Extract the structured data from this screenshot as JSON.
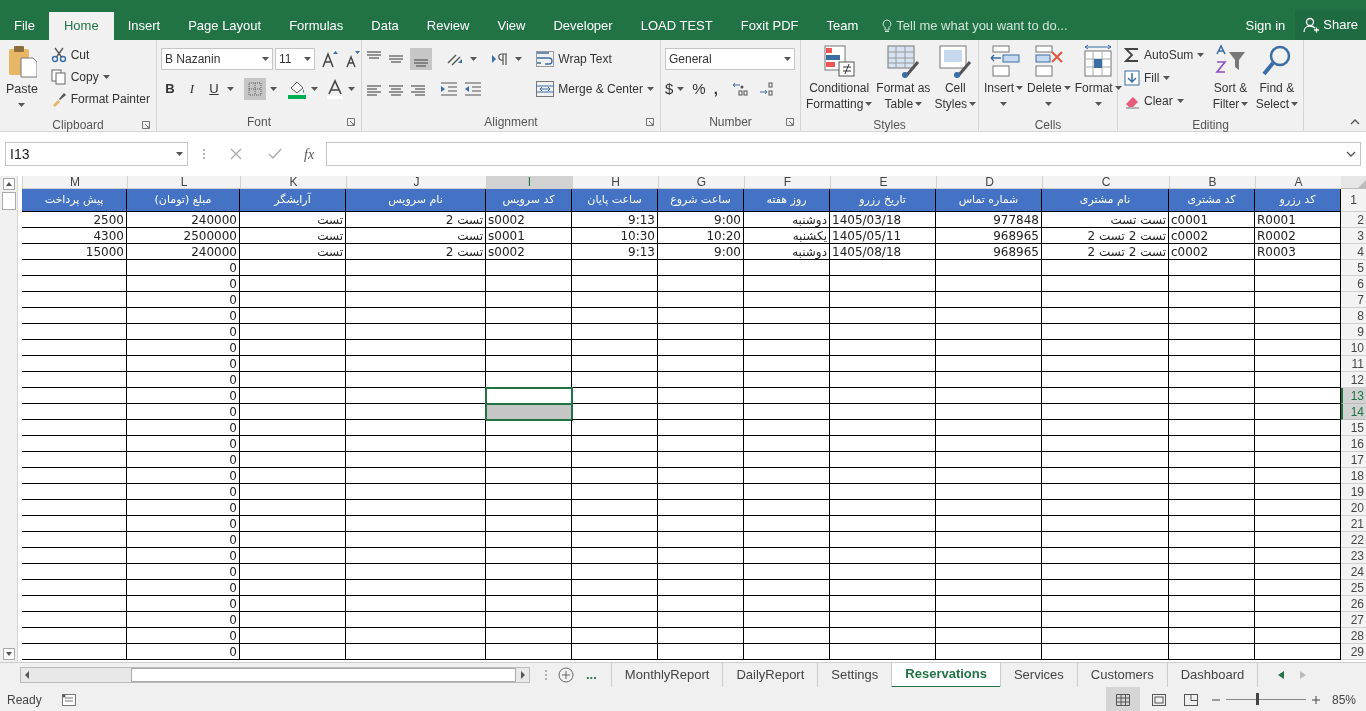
{
  "ribbon_tabs": [
    {
      "label": "File",
      "selected": false
    },
    {
      "label": "Home",
      "selected": true
    },
    {
      "label": "Insert",
      "selected": false
    },
    {
      "label": "Page Layout",
      "selected": false
    },
    {
      "label": "Formulas",
      "selected": false
    },
    {
      "label": "Data",
      "selected": false
    },
    {
      "label": "Review",
      "selected": false
    },
    {
      "label": "View",
      "selected": false
    },
    {
      "label": "Developer",
      "selected": false
    },
    {
      "label": "LOAD TEST",
      "selected": false
    },
    {
      "label": "Foxit PDF",
      "selected": false
    },
    {
      "label": "Team",
      "selected": false
    }
  ],
  "tell_me": "Tell me what you want to do...",
  "sign_in": "Sign in",
  "share": "Share",
  "clipboard": {
    "paste": "Paste",
    "cut": "Cut",
    "copy": "Copy",
    "format_painter": "Format Painter",
    "label": "Clipboard"
  },
  "font": {
    "name": "B Nazanin",
    "size": "11",
    "style_buttons": [
      "B",
      "I",
      "U"
    ],
    "label": "Font"
  },
  "alignment": {
    "wrap_text": "Wrap Text",
    "merge_center": "Merge & Center",
    "label": "Alignment"
  },
  "number": {
    "format": "General",
    "buttons": [
      "$",
      "%",
      ","
    ],
    "label": "Number"
  },
  "styles": {
    "buttons": [
      [
        "Conditional",
        "Formatting"
      ],
      [
        "Format as",
        "Table"
      ],
      [
        "Cell",
        "Styles"
      ]
    ],
    "label": "Styles"
  },
  "cells": {
    "buttons": [
      "Insert",
      "Delete",
      "Format"
    ],
    "label": "Cells"
  },
  "editing": {
    "autosum": "AutoSum",
    "fill": "Fill",
    "clear": "Clear",
    "sort": [
      "Sort &",
      "Filter"
    ],
    "find": [
      "Find &",
      "Select"
    ],
    "label": "Editing"
  },
  "formula_bar": {
    "name_box": "I13",
    "fx": "fx"
  },
  "columns": [
    {
      "letter": "M",
      "selected": false
    },
    {
      "letter": "L",
      "selected": false
    },
    {
      "letter": "K",
      "selected": false
    },
    {
      "letter": "J",
      "selected": false
    },
    {
      "letter": "I",
      "selected": true
    },
    {
      "letter": "H",
      "selected": false
    },
    {
      "letter": "G",
      "selected": false
    },
    {
      "letter": "F",
      "selected": false
    },
    {
      "letter": "E",
      "selected": false
    },
    {
      "letter": "D",
      "selected": false
    },
    {
      "letter": "C",
      "selected": false
    },
    {
      "letter": "B",
      "selected": false
    },
    {
      "letter": "A",
      "selected": false
    }
  ],
  "header_row": {
    "number": "1",
    "cells": {
      "A": "کد رزرو",
      "B": "کد مشتری",
      "C": "نام مشتری",
      "D": "شماره تماس",
      "E": "تاریخ رزرو",
      "F": "روز هفته",
      "G": "ساعت شروع",
      "H": "ساعت پایان",
      "I": "کد سرویس",
      "J": "نام سرویس",
      "K": "آرایشگر",
      "L": "مبلغ (تومان)",
      "M": "پیش پرداخت"
    }
  },
  "rows": [
    {
      "number": "2",
      "selected": false,
      "cells": {
        "A": "R0001",
        "B": "c0001",
        "C": "تست تست",
        "D": "977848",
        "E": "1405/03/18",
        "F": "دوشنبه",
        "G": "9:00",
        "H": "9:13",
        "I": "s0002",
        "J": "تست 2",
        "K": "تست",
        "L": "240000",
        "M": "2500"
      }
    },
    {
      "number": "3",
      "selected": false,
      "cells": {
        "A": "R0002",
        "B": "c0002",
        "C": "تست 2 تست 2",
        "D": "968965",
        "E": "1405/05/11",
        "F": "یکشنبه",
        "G": "10:20",
        "H": "10:30",
        "I": "s0001",
        "J": "تست",
        "K": "تست",
        "L": "2500000",
        "M": "4300"
      }
    },
    {
      "number": "4",
      "selected": false,
      "cells": {
        "A": "R0003",
        "B": "c0002",
        "C": "تست 2 تست 2",
        "D": "968965",
        "E": "1405/08/18",
        "F": "دوشنبه",
        "G": "9:00",
        "H": "9:13",
        "I": "s0002",
        "J": "تست 2",
        "K": "تست",
        "L": "240000",
        "M": "15000"
      }
    },
    {
      "number": "5",
      "selected": false,
      "cells": {
        "L": "0"
      }
    },
    {
      "number": "6",
      "selected": false,
      "cells": {
        "L": "0"
      }
    },
    {
      "number": "7",
      "selected": false,
      "cells": {
        "L": "0"
      }
    },
    {
      "number": "8",
      "selected": false,
      "cells": {
        "L": "0"
      }
    },
    {
      "number": "9",
      "selected": false,
      "cells": {
        "L": "0"
      }
    },
    {
      "number": "10",
      "selected": false,
      "cells": {
        "L": "0"
      }
    },
    {
      "number": "11",
      "selected": false,
      "cells": {
        "L": "0"
      }
    },
    {
      "number": "12",
      "selected": false,
      "cells": {
        "L": "0"
      }
    },
    {
      "number": "13",
      "selected": true,
      "cells": {
        "L": "0"
      }
    },
    {
      "number": "14",
      "selected": true,
      "cells": {
        "L": "0"
      }
    },
    {
      "number": "15",
      "selected": false,
      "cells": {
        "L": "0"
      }
    },
    {
      "number": "16",
      "selected": false,
      "cells": {
        "L": "0"
      }
    },
    {
      "number": "17",
      "selected": false,
      "cells": {
        "L": "0"
      }
    },
    {
      "number": "18",
      "selected": false,
      "cells": {
        "L": "0"
      }
    },
    {
      "number": "19",
      "selected": false,
      "cells": {
        "L": "0"
      }
    },
    {
      "number": "20",
      "selected": false,
      "cells": {
        "L": "0"
      }
    },
    {
      "number": "21",
      "selected": false,
      "cells": {
        "L": "0"
      }
    },
    {
      "number": "22",
      "selected": false,
      "cells": {
        "L": "0"
      }
    },
    {
      "number": "23",
      "selected": false,
      "cells": {
        "L": "0"
      }
    },
    {
      "number": "24",
      "selected": false,
      "cells": {
        "L": "0"
      }
    },
    {
      "number": "25",
      "selected": false,
      "cells": {
        "L": "0"
      }
    },
    {
      "number": "26",
      "selected": false,
      "cells": {
        "L": "0"
      }
    },
    {
      "number": "27",
      "selected": false,
      "cells": {
        "L": "0"
      }
    },
    {
      "number": "28",
      "selected": false,
      "cells": {
        "L": "0"
      }
    },
    {
      "number": "29",
      "selected": false,
      "cells": {
        "L": "0"
      }
    }
  ],
  "more_sheets": "...",
  "sheet_tabs": [
    {
      "label": "MonthlyReport",
      "selected": false
    },
    {
      "label": "DailyReport",
      "selected": false
    },
    {
      "label": "Settings",
      "selected": false
    },
    {
      "label": "Reservations",
      "selected": true
    },
    {
      "label": "Services",
      "selected": false
    },
    {
      "label": "Customers",
      "selected": false
    },
    {
      "label": "Dashboard",
      "selected": false
    }
  ],
  "status": "Ready",
  "zoom": {
    "level": 0.39,
    "reading": "85%"
  }
}
